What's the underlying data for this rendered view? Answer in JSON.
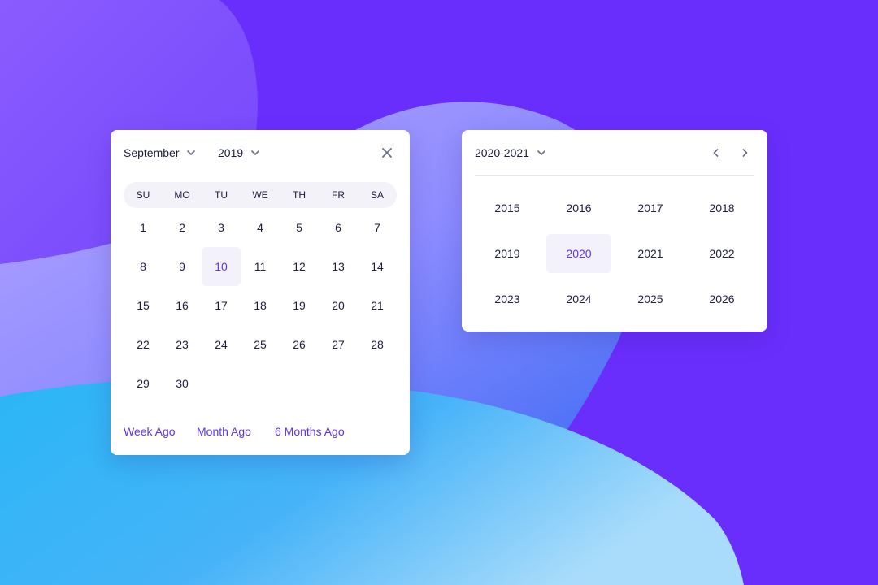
{
  "calendar": {
    "month": "September",
    "year": "2019",
    "weekdays": [
      "SU",
      "MO",
      "TU",
      "WE",
      "TH",
      "FR",
      "SA"
    ],
    "days": [
      "1",
      "2",
      "3",
      "4",
      "5",
      "6",
      "7",
      "8",
      "9",
      "10",
      "11",
      "12",
      "13",
      "14",
      "15",
      "16",
      "17",
      "18",
      "19",
      "20",
      "21",
      "22",
      "23",
      "24",
      "25",
      "26",
      "27",
      "28",
      "29",
      "30"
    ],
    "selected_day": "10",
    "quick_links": [
      "Week Ago",
      "Month Ago",
      "6 Months Ago"
    ]
  },
  "year_picker": {
    "range": "2020-2021",
    "years": [
      "2015",
      "2016",
      "2017",
      "2018",
      "2019",
      "2020",
      "2021",
      "2022",
      "2023",
      "2024",
      "2025",
      "2026"
    ],
    "selected_year": "2020"
  },
  "icons": {
    "dropdown": "chevron-down-icon",
    "close": "close-icon",
    "prev": "chevron-left-icon",
    "next": "chevron-right-icon"
  },
  "colors": {
    "accent": "#6234f0",
    "text": "#1d1e3c",
    "background": "#6a2efc",
    "selected_bg": "#f3f2fc",
    "weekday_bar": "#f3f2f9"
  }
}
